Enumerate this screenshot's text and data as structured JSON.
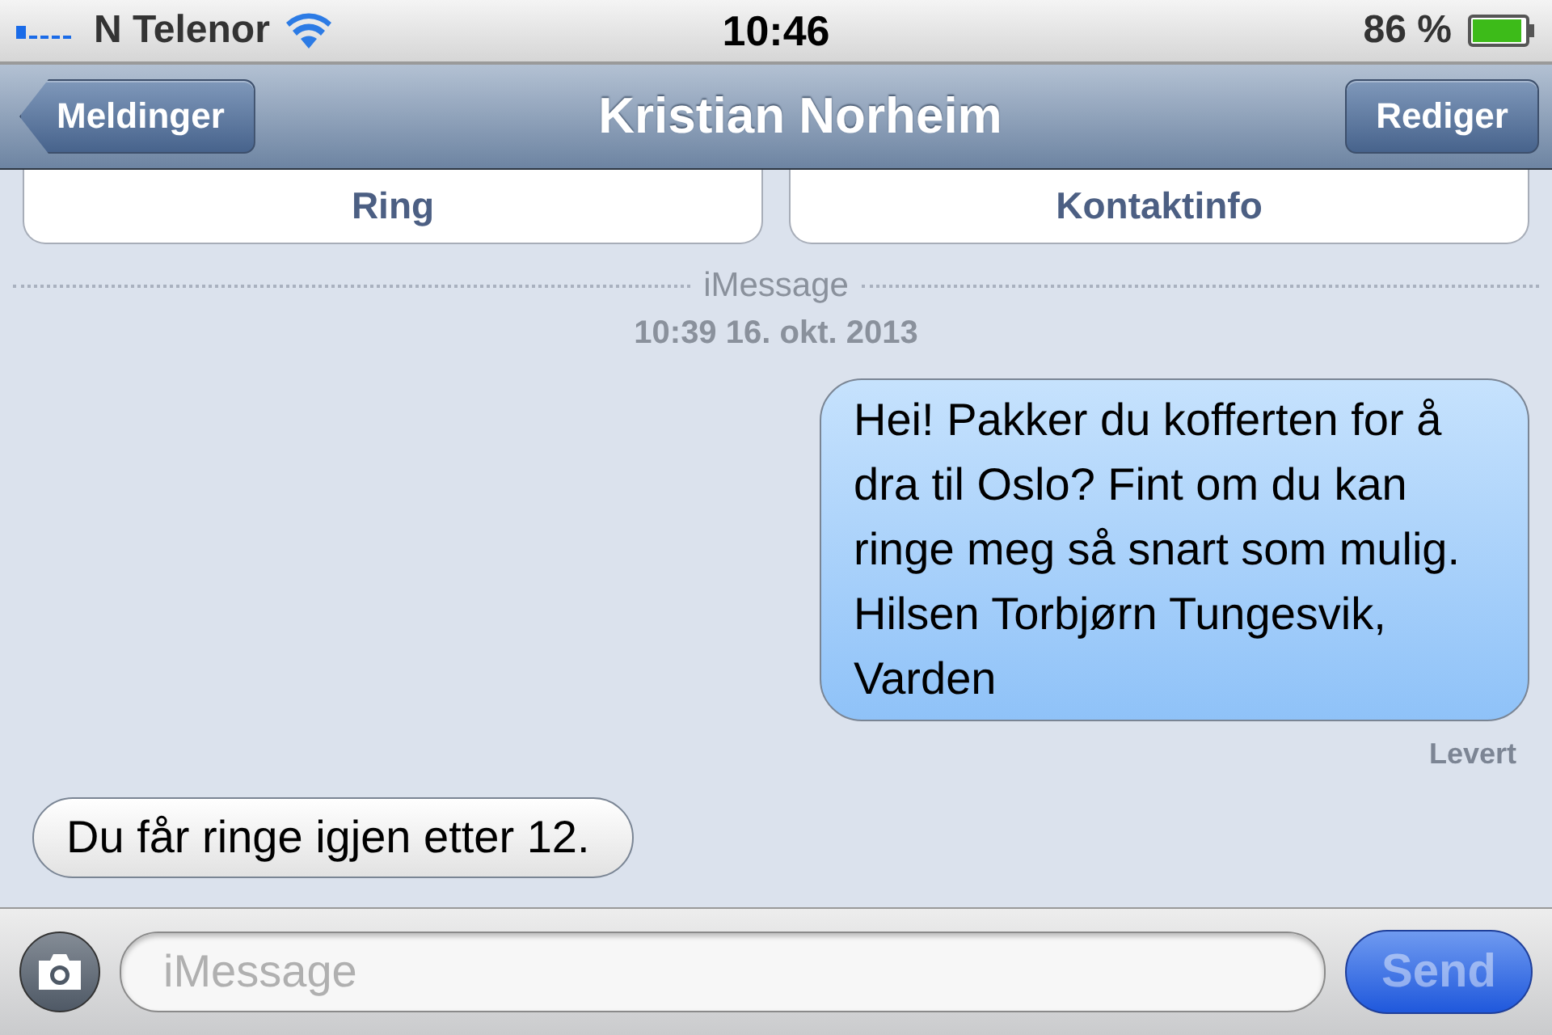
{
  "status_bar": {
    "carrier": "N Telenor",
    "time": "10:46",
    "battery": "86 %"
  },
  "nav_bar": {
    "back": "Meldinger",
    "title": "Kristian Norheim",
    "edit": "Rediger"
  },
  "contact_actions": [
    "Ring",
    "Kontaktinfo"
  ],
  "service_label": "iMessage",
  "timestamp": "10:39 16. okt. 2013",
  "messages": [
    {
      "kind": "sent",
      "text": "Hei! Pakker du kofferten for å dra til Oslo? Fint om du kan ringe meg så snart som mulig. Hilsen Torbjørn Tungesvik, Varden",
      "status": "Levert"
    },
    {
      "kind": "received",
      "text": "Du får ringe igjen etter 12."
    }
  ],
  "composer": {
    "placeholder": "iMessage",
    "send": "Send",
    "send_disabled": true
  }
}
